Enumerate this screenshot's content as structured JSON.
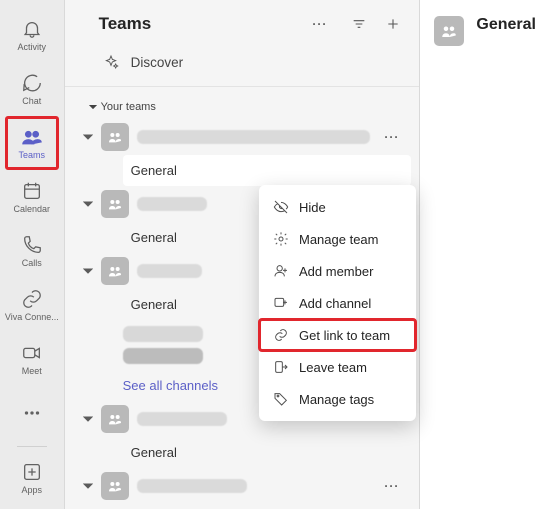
{
  "rail": {
    "items": [
      {
        "name": "activity",
        "label": "Activity",
        "icon": "bell-icon"
      },
      {
        "name": "chat",
        "label": "Chat",
        "icon": "chat-icon"
      },
      {
        "name": "teams",
        "label": "Teams",
        "icon": "people-icon",
        "active": true
      },
      {
        "name": "calendar",
        "label": "Calendar",
        "icon": "calendar-icon"
      },
      {
        "name": "calls",
        "label": "Calls",
        "icon": "phone-icon"
      },
      {
        "name": "viva",
        "label": "Viva Conne...",
        "icon": "link-icon"
      },
      {
        "name": "meet",
        "label": "Meet",
        "icon": "video-icon"
      },
      {
        "name": "more",
        "label": "",
        "icon": "more-icon"
      },
      {
        "name": "apps",
        "label": "Apps",
        "icon": "apps-icon"
      }
    ]
  },
  "panel": {
    "title": "Teams",
    "discover_label": "Discover",
    "section_label": "Your teams",
    "see_all_label": "See all channels",
    "teams": [
      {
        "name_redacted": true,
        "channels": [
          {
            "label": "General",
            "selected": true
          }
        ],
        "menu_open": true
      },
      {
        "name_redacted": true,
        "channels": [
          {
            "label": "General"
          }
        ]
      },
      {
        "name_redacted": true,
        "channels": [
          {
            "label": "General"
          },
          {
            "redacted": true
          },
          {
            "redacted": true,
            "bold": true
          }
        ],
        "see_all": true
      },
      {
        "name_redacted": true,
        "channels": [
          {
            "label": "General"
          }
        ]
      },
      {
        "name_redacted": true,
        "channels": []
      }
    ]
  },
  "menu": {
    "items": [
      {
        "key": "hide",
        "label": "Hide",
        "icon": "eye-off-icon"
      },
      {
        "key": "manage",
        "label": "Manage team",
        "icon": "gear-icon"
      },
      {
        "key": "add_member",
        "label": "Add member",
        "icon": "add-member-icon"
      },
      {
        "key": "add_channel",
        "label": "Add channel",
        "icon": "add-channel-icon"
      },
      {
        "key": "get_link",
        "label": "Get link to team",
        "icon": "link-icon",
        "highlight": true
      },
      {
        "key": "leave",
        "label": "Leave team",
        "icon": "leave-icon"
      },
      {
        "key": "tags",
        "label": "Manage tags",
        "icon": "tag-icon"
      }
    ]
  },
  "content": {
    "channel_title": "General"
  }
}
